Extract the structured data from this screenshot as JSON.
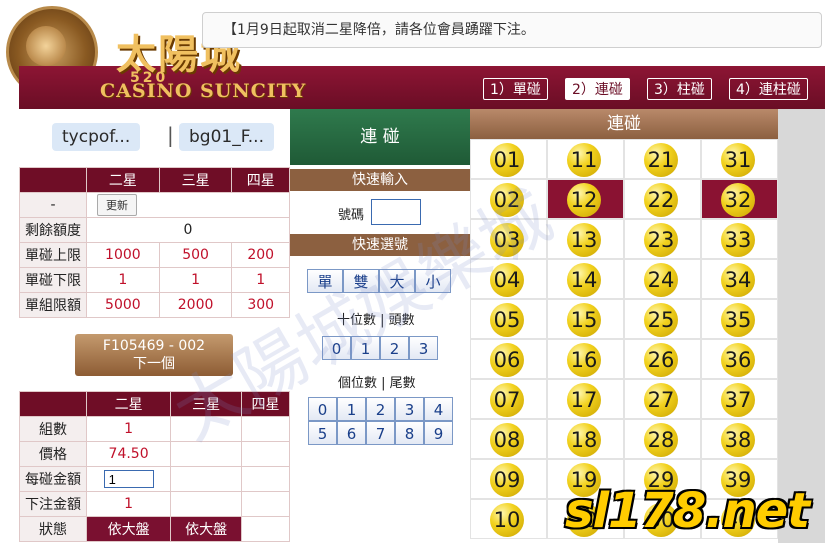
{
  "marquee": {
    "text": "【1月9日起取消二星降倍，請各位會員踴躍下注。"
  },
  "logo": {
    "brand": "太陽城",
    "subtitle": "CASINO SUNCITY",
    "number": "520"
  },
  "mode_tabs": [
    {
      "label": "1）單碰",
      "active": false
    },
    {
      "label": "2）連碰",
      "active": true
    },
    {
      "label": "3）柱碰",
      "active": false
    },
    {
      "label": "4）連柱碰",
      "active": false
    }
  ],
  "accounts": {
    "account1": "tycpof...",
    "separator": "|",
    "account2": "bg01_F..."
  },
  "limits": {
    "headers": [
      "二星",
      "三星",
      "四星"
    ],
    "first_label": "-",
    "update_label": "更新",
    "rows": [
      {
        "label": "剩餘額度",
        "values": [
          "0"
        ]
      },
      {
        "label": "單碰上限",
        "values": [
          "1000",
          "500",
          "200"
        ]
      },
      {
        "label": "單碰下限",
        "values": [
          "1",
          "1",
          "1"
        ]
      },
      {
        "label": "單組限額",
        "values": [
          "5000",
          "2000",
          "300"
        ]
      }
    ]
  },
  "next_button": {
    "line1": "F105469 - 002",
    "line2": "下一個"
  },
  "order": {
    "headers": [
      "二星",
      "三星",
      "四星"
    ],
    "rows": [
      {
        "label": "組數",
        "value": "1"
      },
      {
        "label": "價格",
        "value": "74.50"
      },
      {
        "label": "每碰金額",
        "value": "1"
      },
      {
        "label": "下注金額",
        "value": "1"
      },
      {
        "label": "狀態",
        "values": [
          "依大盤",
          "依大盤"
        ]
      }
    ]
  },
  "middle": {
    "title": "連 碰",
    "quick_input": "快速輸入",
    "number_label": "號碼",
    "quick_select": "快速選號",
    "type_buttons": [
      "單",
      "雙",
      "大",
      "小"
    ],
    "tens_label": "十位數 | 頭數",
    "tens_buttons": [
      "0",
      "1",
      "2",
      "3"
    ],
    "units_label": "個位數 | 尾數",
    "units_buttons": [
      "0",
      "1",
      "2",
      "3",
      "4",
      "5",
      "6",
      "7",
      "8",
      "9"
    ]
  },
  "grid": {
    "title": "連碰",
    "columns": [
      [
        "01",
        "02",
        "03",
        "04",
        "05",
        "06",
        "07",
        "08",
        "09",
        "10"
      ],
      [
        "11",
        "12",
        "13",
        "14",
        "15",
        "16",
        "17",
        "18",
        "19",
        "20"
      ],
      [
        "21",
        "22",
        "23",
        "24",
        "25",
        "26",
        "27",
        "28",
        "29",
        "30"
      ],
      [
        "31",
        "32",
        "33",
        "34",
        "35",
        "36",
        "37",
        "38",
        "39",
        "40"
      ]
    ],
    "selected": [
      "12",
      "32"
    ]
  },
  "watermark": "太陽城娛樂城",
  "site_logo": "sl178.net",
  "colors": {
    "maroon": "#7a1030",
    "green": "#2a6e45",
    "gold": "#f2d21e",
    "brown": "#8c6040"
  }
}
